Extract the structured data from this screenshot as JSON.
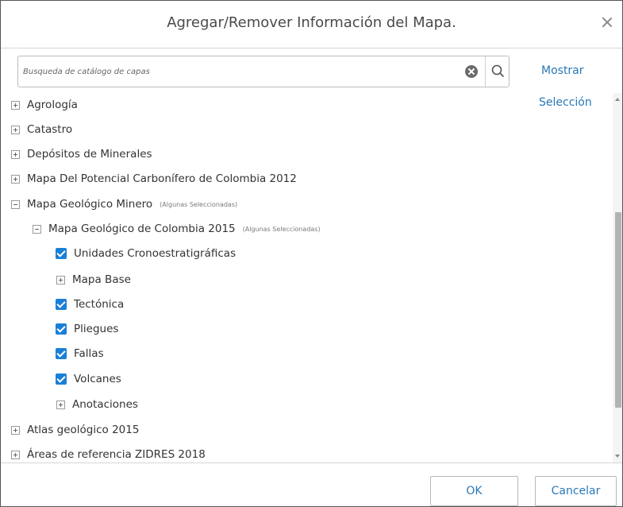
{
  "dialog": {
    "title": "Agregar/Remover Información del Mapa.",
    "close_icon": "close-icon"
  },
  "search": {
    "placeholder": "Busqueda de catálogo de capas",
    "value": "",
    "clear_icon": "clear-circle-icon",
    "search_icon": "search-icon"
  },
  "links": {
    "show": "Mostrar",
    "selection": "Selección"
  },
  "tree": {
    "items": [
      {
        "label": "Agrología",
        "state": "collapsed"
      },
      {
        "label": "Catastro",
        "state": "collapsed"
      },
      {
        "label": "Depósitos de Minerales",
        "state": "collapsed"
      },
      {
        "label": "Mapa Del Potencial Carbonífero de Colombia 2012",
        "state": "collapsed"
      },
      {
        "label": "Mapa Geológico Minero",
        "state": "expanded",
        "note": "(Algunas Seleccionadas)"
      },
      {
        "label": "Mapa Geológico de Colombia 2015",
        "state": "expanded",
        "note": "(Algunas Seleccionadas)"
      },
      {
        "label": "Unidades Cronoestratigráficas",
        "state": "checked"
      },
      {
        "label": "Mapa Base",
        "state": "collapsed"
      },
      {
        "label": "Tectónica",
        "state": "checked"
      },
      {
        "label": "Pliegues",
        "state": "checked"
      },
      {
        "label": "Fallas",
        "state": "checked"
      },
      {
        "label": "Volcanes",
        "state": "checked"
      },
      {
        "label": "Anotaciones",
        "state": "collapsed"
      },
      {
        "label": "Atlas geológico 2015",
        "state": "collapsed"
      },
      {
        "label": "Áreas de referencia ZIDRES 2018",
        "state": "collapsed"
      }
    ]
  },
  "footer": {
    "ok": "OK",
    "cancel": "Cancelar"
  },
  "colors": {
    "accent": "#2a78b7",
    "checkbox": "#1a7fd6"
  }
}
